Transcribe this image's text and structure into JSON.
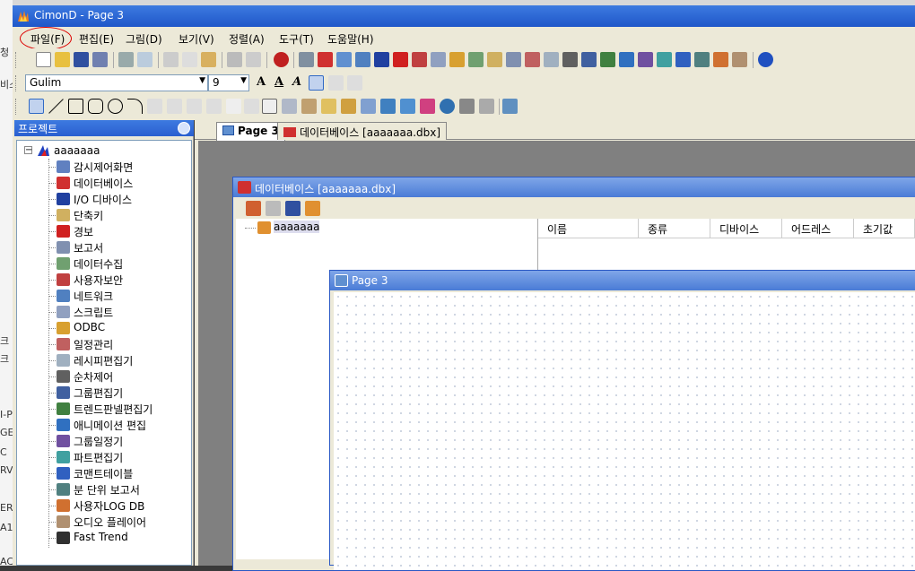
{
  "app": {
    "title": "CimonD - Page 3"
  },
  "menu": [
    "파일(F)",
    "편집(E)",
    "그림(D)",
    "보기(V)",
    "정렬(A)",
    "도구(T)",
    "도움말(H)"
  ],
  "font_toolbar": {
    "font": "Gulim",
    "size": "9",
    "bold": "A",
    "italic": "A",
    "underline": "A"
  },
  "panel": {
    "title": "프로젝트"
  },
  "tree": {
    "root": "aaaaaaa",
    "items": [
      "감시제어화면",
      "데이터베이스",
      "I/O 디바이스",
      "단축키",
      "경보",
      "보고서",
      "데이터수집",
      "사용자보안",
      "네트워크",
      "스크립트",
      "ODBC",
      "일정관리",
      "레시피편집기",
      "순차제어",
      "그룹편집기",
      "트렌드판넬편집기",
      "애니메이션 편집",
      "그룹일정기",
      "파트편집기",
      "코맨트테이블",
      "분 단위 보고서",
      "사용자LOG DB",
      "오디오 플레이어",
      "Fast Trend"
    ]
  },
  "tabs": [
    {
      "label": "Page 3",
      "active": true
    },
    {
      "label": "데이터베이스 [aaaaaaa.dbx]",
      "active": false
    }
  ],
  "db_window": {
    "title": "데이터베이스 [aaaaaaa.dbx]",
    "tree_root": "aaaaaaa",
    "columns": [
      "이름",
      "종류",
      "디바이스",
      "어드레스",
      "초기값"
    ]
  },
  "page_window": {
    "title": "Page 3"
  },
  "left_strip": [
    "청",
    "비스",
    "크",
    "크",
    "I-P",
    "GE",
    "C",
    "RVI",
    "ER",
    "A1",
    "AC"
  ],
  "colors": {
    "titlebar": "#2a5fd0",
    "face": "#ece9d8",
    "accent_red": "#d00000"
  }
}
